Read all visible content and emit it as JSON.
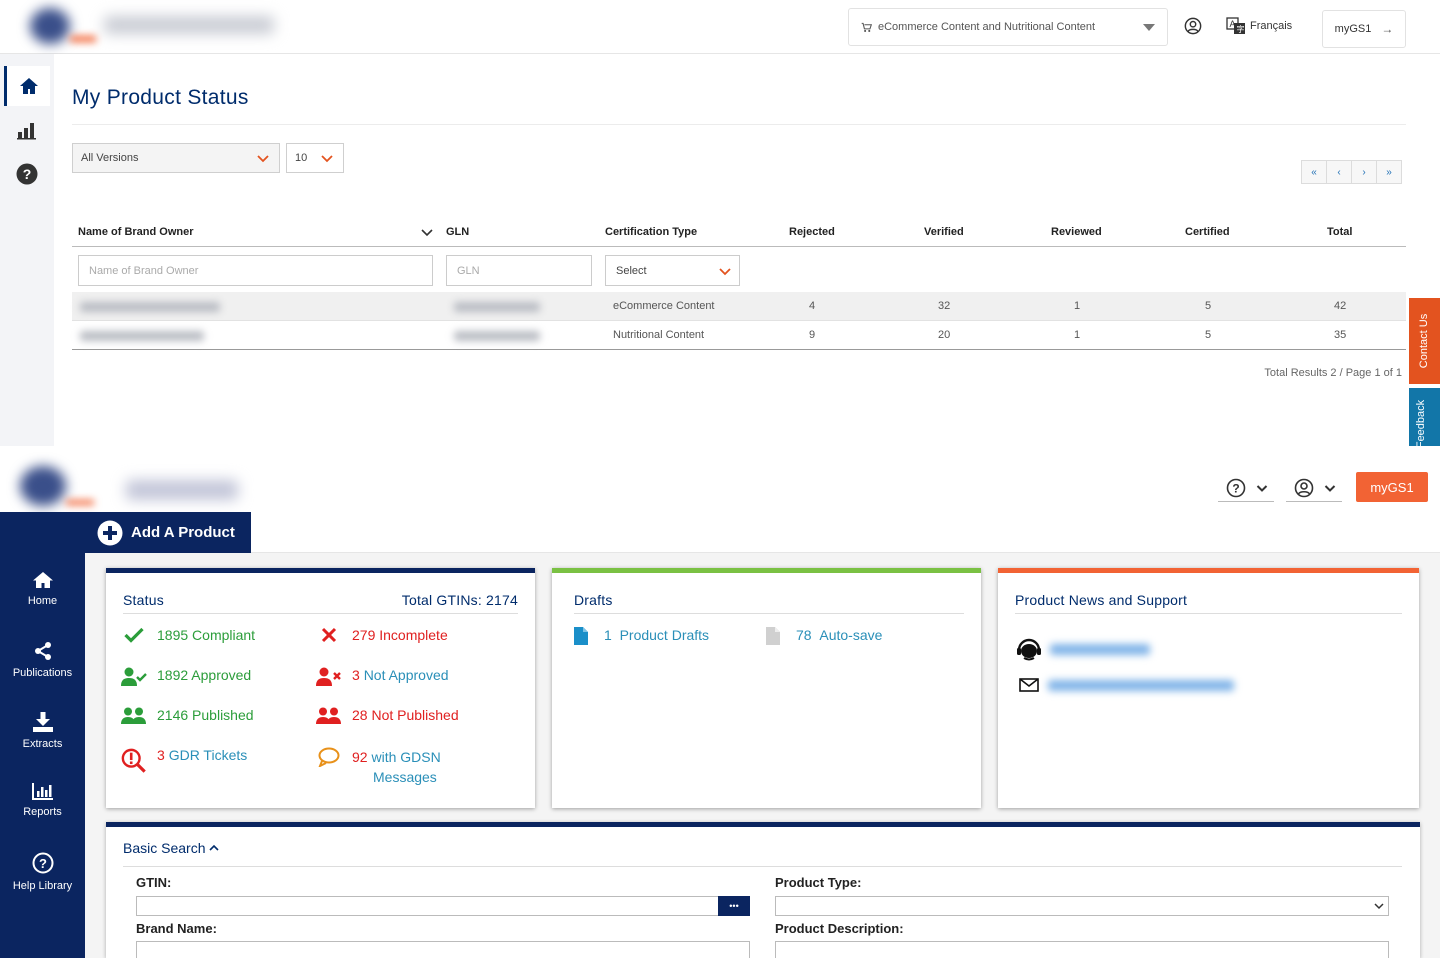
{
  "panel1": {
    "app_name": "Product Certification",
    "content_selector": "eCommerce Content and Nutritional Content",
    "language": "Français",
    "mygs1": "myGS1",
    "page_title": "My Product Status",
    "version_select": "All Versions",
    "page_size_select": "10",
    "pager": [
      "«",
      "‹",
      "›",
      "»"
    ],
    "columns": [
      "Name of Brand Owner",
      "GLN",
      "Certification Type",
      "Rejected",
      "Verified",
      "Reviewed",
      "Certified",
      "Total"
    ],
    "filters": {
      "brand_owner_placeholder": "Name of Brand Owner",
      "gln_placeholder": "GLN",
      "cert_type_select": "Select"
    },
    "rows": [
      {
        "cert_type": "eCommerce Content",
        "rejected": "4",
        "verified": "32",
        "reviewed": "1",
        "certified": "5",
        "total": "42"
      },
      {
        "cert_type": "Nutritional Content",
        "rejected": "9",
        "verified": "20",
        "reviewed": "1",
        "certified": "5",
        "total": "35"
      }
    ],
    "total_results": "Total Results 2 / Page 1 of 1",
    "contact_tab": "Contact Us",
    "feedback_tab": "Feedback"
  },
  "panel2": {
    "app_name": "ProSYNC",
    "mygs1": "myGS1",
    "add_product": "Add A Product",
    "nav": [
      {
        "label": "Home",
        "icon": "home-icon"
      },
      {
        "label": "Publications",
        "icon": "share-icon"
      },
      {
        "label": "Extracts",
        "icon": "download-icon"
      },
      {
        "label": "Reports",
        "icon": "bar-chart-icon"
      },
      {
        "label": "Help Library",
        "icon": "help-icon"
      }
    ],
    "status": {
      "title": "Status",
      "total_gtins": "Total GTINs: 2174",
      "compliant_count": "1895",
      "compliant_label": "Compliant",
      "incomplete_count": "279",
      "incomplete_label": "Incomplete",
      "approved_count": "1892",
      "approved_label": "Approved",
      "not_approved_count": "3",
      "not_approved_label": "Not Approved",
      "published_count": "2146",
      "published_label": "Published",
      "not_published_count": "28",
      "not_published_label": "Not Published",
      "gdr_count": "3",
      "gdr_label": "GDR Tickets",
      "gdsn_count": "92",
      "gdsn_label_1": "with GDSN",
      "gdsn_label_2": "Messages"
    },
    "drafts": {
      "title": "Drafts",
      "product_drafts_count": "1",
      "product_drafts_label": "Product Drafts",
      "autosave_count": "78",
      "autosave_label": "Auto-save"
    },
    "news": {
      "title": "Product News and Support"
    },
    "basic_search": {
      "title": "Basic Search",
      "gtin_label": "GTIN:",
      "gtin_button": "•••",
      "product_type_label": "Product Type:",
      "brand_name_label": "Brand Name:",
      "product_description_label": "Product Description:"
    },
    "colors": {
      "navy": "#0b2560",
      "orange": "#f26334",
      "green_bar": "#7ac143",
      "compliant_green": "#2b9d3a",
      "alert_red": "#e02020"
    }
  }
}
